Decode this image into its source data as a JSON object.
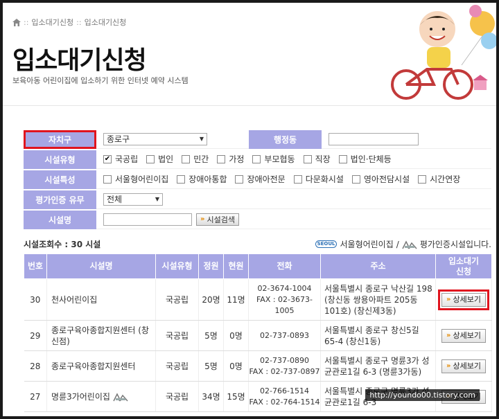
{
  "breadcrumb": {
    "items": [
      "입소대기신청",
      "입소대기신청"
    ],
    "separator": "::"
  },
  "page": {
    "title": "입소대기신청",
    "subtitle": "보육아동 어린이집에 입소하기 위한 인터넷 예약 시스템"
  },
  "search": {
    "district": {
      "label": "자치구",
      "value": "종로구"
    },
    "dong": {
      "label": "행정동",
      "value": ""
    },
    "facility_type": {
      "label": "시설유형",
      "options": [
        {
          "label": "국공립",
          "checked": true
        },
        {
          "label": "법인",
          "checked": false
        },
        {
          "label": "민간",
          "checked": false
        },
        {
          "label": "가정",
          "checked": false
        },
        {
          "label": "부모협동",
          "checked": false
        },
        {
          "label": "직장",
          "checked": false
        },
        {
          "label": "법인·단체등",
          "checked": false
        }
      ]
    },
    "facility_feature": {
      "label": "시설특성",
      "options": [
        {
          "label": "서울형어린이집",
          "checked": false
        },
        {
          "label": "장애아통합",
          "checked": false
        },
        {
          "label": "장애아전문",
          "checked": false
        },
        {
          "label": "다문화시설",
          "checked": false
        },
        {
          "label": "영아전담시설",
          "checked": false
        },
        {
          "label": "시간연장",
          "checked": false
        }
      ]
    },
    "accreditation": {
      "label": "평가인증 유무",
      "value": "전체"
    },
    "facility_name": {
      "label": "시설명",
      "value": "",
      "button_label": "시설검색"
    }
  },
  "results": {
    "count_text": "시설조회수 : 30 시설",
    "legend_seoul": "서울형어린이집",
    "legend_separator": "/",
    "legend_accredited": "평가인증시설입니다.",
    "logo_text": "SEOUL"
  },
  "table": {
    "headers": [
      "번호",
      "시설명",
      "시설유형",
      "정원",
      "현원",
      "전화",
      "주소",
      "입소대기\n신청"
    ],
    "detail_label": "상세보기",
    "rows": [
      {
        "no": "30",
        "name": "천사어린이집",
        "type": "국공립",
        "capacity": "20명",
        "current": "11명",
        "tel": "02-3674-1004",
        "fax": "FAX : 02-3673-1005",
        "addr": "서울특별시 종로구 낙산길 198 (창신동 쌍용아파트 205동 101호) (창신제3동)"
      },
      {
        "no": "29",
        "name": "종로구육아종합지원센터 (창신점)",
        "type": "국공립",
        "capacity": "5명",
        "current": "0명",
        "tel": "02-737-0893",
        "fax": "",
        "addr": "서울특별시 종로구 창신5길 65-4 (창신1동)"
      },
      {
        "no": "28",
        "name": "종로구육아종합지원센터",
        "type": "국공립",
        "capacity": "5명",
        "current": "0명",
        "tel": "02-737-0890",
        "fax": "FAX : 02-737-0897",
        "addr": "서울특별시 종로구 명륜3가 성균관로1길 6-3 (명륜3가동)"
      },
      {
        "no": "27",
        "name": "명륜3가어린이집",
        "type": "국공립",
        "capacity": "34명",
        "current": "15명",
        "tel": "02-766-1514",
        "fax": "FAX : 02-764-1514",
        "addr": "서울특별시 종로구 명륜3가 성균관로1길 6-3"
      }
    ]
  },
  "watermark": "http://youndo00.tistory.com",
  "colors": {
    "header_bg": "#a6a6e4",
    "highlight": "#e0141e",
    "accent": "#e58a00"
  }
}
